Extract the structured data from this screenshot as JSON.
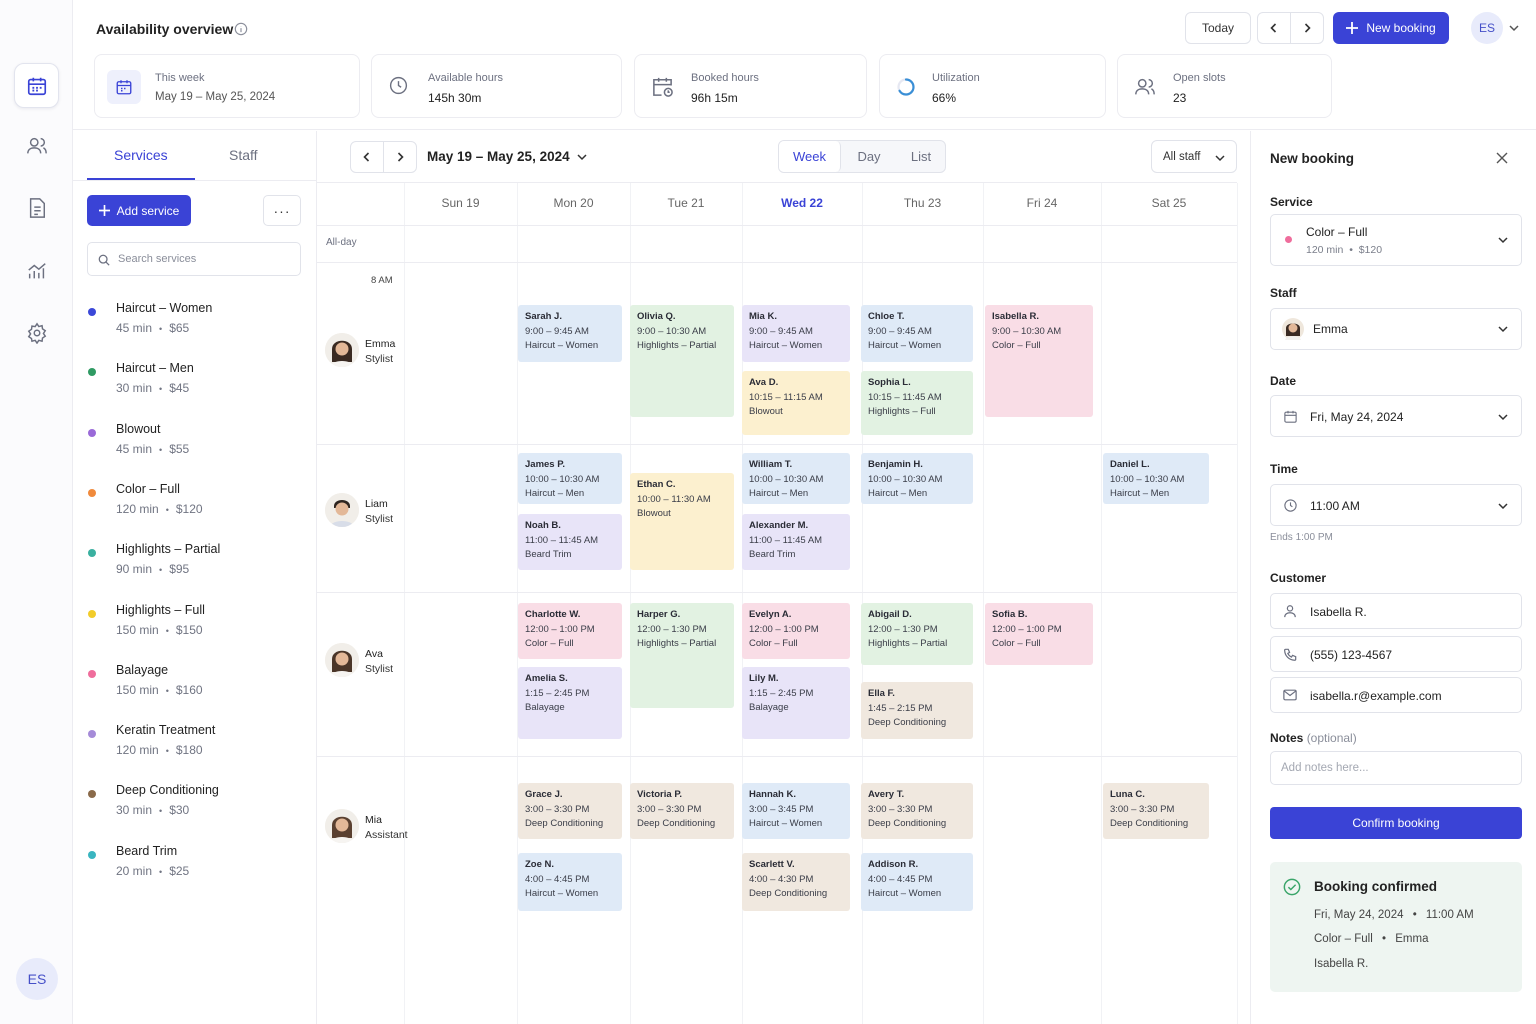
{
  "header": {
    "title": "Availability overview",
    "today_label": "Today",
    "new_booking_label": "New booking",
    "user_initials": "ES",
    "stats": [
      {
        "label": "This week",
        "value": "May 19 – May 25, 2024",
        "icon": "calendar-icon"
      },
      {
        "label": "Available hours",
        "value": "145h 30m",
        "icon": "clock-icon"
      },
      {
        "label": "Booked hours",
        "value": "96h 15m",
        "icon": "calendar-clock-icon"
      },
      {
        "label": "Utilization",
        "value": "66%",
        "icon": "progress-ring-icon",
        "fraction": 0.66
      },
      {
        "label": "Open slots",
        "value": "23",
        "icon": "users-icon"
      }
    ]
  },
  "rail": {
    "items": [
      "calendar-icon",
      "users-icon",
      "document-icon",
      "chart-icon",
      "settings-icon"
    ],
    "avatar_initials": "ES"
  },
  "services_panel": {
    "tabs": [
      "Services",
      "Staff"
    ],
    "add_label": "Add service",
    "more_label": "···",
    "search_placeholder": "Search services",
    "items": [
      {
        "name": "Haircut – Women",
        "duration": "45 min",
        "price": "$65",
        "color": "#3b48d8"
      },
      {
        "name": "Haircut – Men",
        "duration": "30 min",
        "price": "$45",
        "color": "#2f9a63"
      },
      {
        "name": "Blowout",
        "duration": "45 min",
        "price": "$55",
        "color": "#9a6ad8"
      },
      {
        "name": "Color – Full",
        "duration": "120 min",
        "price": "$120",
        "color": "#f08a3c"
      },
      {
        "name": "Highlights – Partial",
        "duration": "90 min",
        "price": "$95",
        "color": "#3ab0a0"
      },
      {
        "name": "Highlights – Full",
        "duration": "150 min",
        "price": "$150",
        "color": "#f2cc2a"
      },
      {
        "name": "Balayage",
        "duration": "150 min",
        "price": "$160",
        "color": "#ef6d9c"
      },
      {
        "name": "Keratin Treatment",
        "duration": "120 min",
        "price": "$180",
        "color": "#a58bd8"
      },
      {
        "name": "Deep Conditioning",
        "duration": "30 min",
        "price": "$30",
        "color": "#8a6a4a"
      },
      {
        "name": "Beard Trim",
        "duration": "20 min",
        "price": "$25",
        "color": "#3ab5c0"
      }
    ]
  },
  "calendar": {
    "range_label": "May 19 – May 25, 2024",
    "views": [
      "Week",
      "Day",
      "List"
    ],
    "active_view": "Week",
    "staff_filter": "All staff",
    "days": [
      "Sun 19",
      "Mon 20",
      "Tue 21",
      "Wed 22",
      "Thu 23",
      "Fri 24",
      "Sat 25"
    ],
    "current_day": "Wed 22",
    "all_day_label": "All-day",
    "hour_label": "8 AM",
    "staff": [
      {
        "name": "Emma",
        "role": "Stylist"
      },
      {
        "name": "Liam",
        "role": "Stylist"
      },
      {
        "name": "Ava",
        "role": "Stylist"
      },
      {
        "name": "Mia",
        "role": "Assistant"
      }
    ],
    "appointments": [
      {
        "client": "Sarah J.",
        "time": "9:00 – 9:45 AM",
        "service": "Haircut – Women",
        "day": 1,
        "color": "#dfeaf7"
      },
      {
        "client": "Olivia Q.",
        "time": "9:00 – 10:30 AM",
        "service": "Highlights – Partial",
        "day": 2,
        "color": "#e2f2e2"
      },
      {
        "client": "Mia K.",
        "time": "9:00 – 9:45 AM",
        "service": "Haircut – Women",
        "day": 3,
        "color": "#e8e4f8"
      },
      {
        "client": "Chloe T.",
        "time": "9:00 – 9:45 AM",
        "service": "Haircut – Women",
        "day": 4,
        "color": "#dfeaf7"
      },
      {
        "client": "Isabella R.",
        "time": "9:00 – 10:30 AM",
        "service": "Color – Full",
        "day": 5,
        "color": "#f9dde6"
      },
      {
        "client": "Ava D.",
        "time": "10:15 – 11:15 AM",
        "service": "Blowout",
        "day": 3,
        "color": "#fcf0cf"
      },
      {
        "client": "Sophia L.",
        "time": "10:15 – 11:45 AM",
        "service": "Highlights – Full",
        "day": 4,
        "color": "#e2f2e2"
      },
      {
        "client": "James P.",
        "time": "10:00 – 10:30 AM",
        "service": "Haircut – Men",
        "day": 1,
        "color": "#dfeaf7"
      },
      {
        "client": "Ethan C.",
        "time": "10:00 – 11:30 AM",
        "service": "Blowout",
        "day": 2,
        "color": "#fcf0cf"
      },
      {
        "client": "William T.",
        "time": "10:00 – 10:30 AM",
        "service": "Haircut – Men",
        "day": 3,
        "color": "#dfeaf7"
      },
      {
        "client": "Benjamin H.",
        "time": "10:00 – 10:30 AM",
        "service": "Haircut – Men",
        "day": 4,
        "color": "#dfeaf7"
      },
      {
        "client": "Daniel L.",
        "time": "10:00 – 10:30 AM",
        "service": "Haircut – Men",
        "day": 6,
        "color": "#dfeaf7"
      },
      {
        "client": "Noah B.",
        "time": "11:00 – 11:45 AM",
        "service": "Beard Trim",
        "day": 1,
        "color": "#e8e4f8"
      },
      {
        "client": "Alexander M.",
        "time": "11:00 – 11:45 AM",
        "service": "Beard Trim",
        "day": 3,
        "color": "#e8e4f8"
      },
      {
        "client": "Charlotte W.",
        "time": "12:00 – 1:00 PM",
        "service": "Color – Full",
        "day": 1,
        "color": "#f9dde6"
      },
      {
        "client": "Harper G.",
        "time": "12:00 – 1:30 PM",
        "service": "Highlights – Partial",
        "day": 2,
        "color": "#e2f2e2"
      },
      {
        "client": "Evelyn A.",
        "time": "12:00 – 1:00 PM",
        "service": "Color – Full",
        "day": 3,
        "color": "#f9dde6"
      },
      {
        "client": "Abigail D.",
        "time": "12:00 – 1:30 PM",
        "service": "Highlights – Partial",
        "day": 4,
        "color": "#e2f2e2"
      },
      {
        "client": "Sofia B.",
        "time": "12:00 – 1:00 PM",
        "service": "Color – Full",
        "day": 5,
        "color": "#f9dde6"
      },
      {
        "client": "Amelia S.",
        "time": "1:15 – 2:45 PM",
        "service": "Balayage",
        "day": 1,
        "color": "#e8e4f8"
      },
      {
        "client": "Lily M.",
        "time": "1:15 – 2:45 PM",
        "service": "Balayage",
        "day": 3,
        "color": "#e8e4f8"
      },
      {
        "client": "Ella F.",
        "time": "1:45 – 2:15 PM",
        "service": "Deep Conditioning",
        "day": 4,
        "color": "#f0e8df"
      },
      {
        "client": "Grace J.",
        "time": "3:00 – 3:30 PM",
        "service": "Deep Conditioning",
        "day": 1,
        "color": "#f0e8df"
      },
      {
        "client": "Victoria P.",
        "time": "3:00 – 3:30 PM",
        "service": "Deep Conditioning",
        "day": 2,
        "color": "#f0e8df"
      },
      {
        "client": "Hannah K.",
        "time": "3:00 – 3:45 PM",
        "service": "Haircut – Women",
        "day": 3,
        "color": "#dfeaf7"
      },
      {
        "client": "Avery T.",
        "time": "3:00 – 3:30 PM",
        "service": "Deep Conditioning",
        "day": 4,
        "color": "#f0e8df"
      },
      {
        "client": "Luna C.",
        "time": "3:00 – 3:30 PM",
        "service": "Deep Conditioning",
        "day": 6,
        "color": "#f0e8df"
      },
      {
        "client": "Zoe N.",
        "time": "4:00 – 4:45 PM",
        "service": "Haircut – Women",
        "day": 1,
        "color": "#dfeaf7"
      },
      {
        "client": "Scarlett V.",
        "time": "4:00 – 4:30 PM",
        "service": "Deep Conditioning",
        "day": 3,
        "color": "#f0e8df"
      },
      {
        "client": "Addison R.",
        "time": "4:00 – 4:45 PM",
        "service": "Haircut – Women",
        "day": 4,
        "color": "#dfeaf7"
      }
    ]
  },
  "booking": {
    "title": "New booking",
    "service_label": "Service",
    "service_value": "Color – Full",
    "service_meta": "120 min  •  $120",
    "service_color": "#ef6d9c",
    "staff_label": "Staff",
    "staff_value": "Emma",
    "date_label": "Date",
    "date_value": "Fri, May 24, 2024",
    "time_label": "Time",
    "time_value": "11:00 AM",
    "ends_label": "Ends 1:00 PM",
    "customer_label": "Customer",
    "customer_name": "Isabella R.",
    "customer_phone": "(555) 123-4567",
    "customer_email": "isabella.r@example.com",
    "notes_label": "Notes",
    "notes_optional": "(optional)",
    "notes_placeholder": "Add notes here...",
    "confirm_label": "Confirm booking",
    "confirmed": {
      "title": "Booking confirmed",
      "date": "Fri, May 24, 2024",
      "time": "11:00 AM",
      "service": "Color – Full",
      "staff": "Emma",
      "customer": "Isabella R."
    }
  },
  "colors": {
    "accent": "#3a43d6",
    "success": "#3aa56a"
  }
}
